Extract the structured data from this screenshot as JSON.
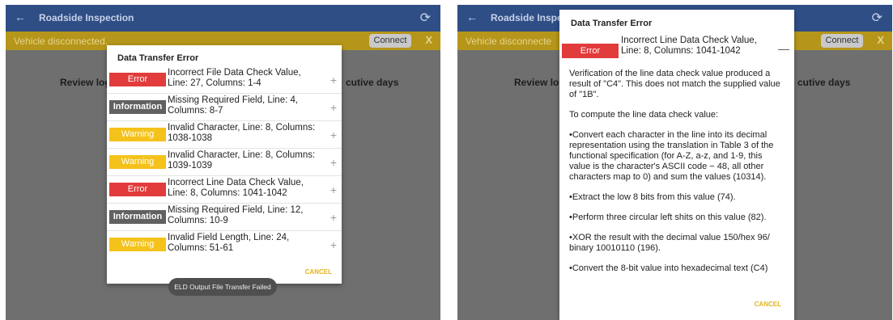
{
  "app": {
    "title": "Roadside Inspection",
    "title_truncated": "Roadside Inspecti",
    "back_glyph": "←",
    "refresh_glyph": "⟳"
  },
  "banner": {
    "text": "Vehicle disconnected.",
    "text_truncated": "Vehicle disconnecte",
    "connect_label": "Connect",
    "close_label": "X"
  },
  "background": {
    "review_left": "Review log",
    "review_right": "Review log",
    "days_text": "cutive days"
  },
  "dialog": {
    "title": "Data Transfer Error",
    "cancel_label": "CANCEL",
    "expand_glyph": "+",
    "collapse_glyph": "—",
    "errors": [
      {
        "type": "Error",
        "text": "Incorrect File Data Check Value, Line: 27, Columns: 1-4"
      },
      {
        "type": "Information",
        "text": "Missing Required Field, Line: 4, Columns: 8-7"
      },
      {
        "type": "Warning",
        "text": "Invalid Character, Line: 8, Columns: 1038-1038"
      },
      {
        "type": "Warning",
        "text": "Invalid Character, Line: 8, Columns: 1039-1039"
      },
      {
        "type": "Error",
        "text": "Incorrect Line Data Check Value, Line: 8, Columns: 1041-1042"
      },
      {
        "type": "Information",
        "text": "Missing Required Field, Line: 12, Columns: 10-9"
      },
      {
        "type": "Warning",
        "text": "Invalid Field Length, Line: 24, Columns: 51-61"
      }
    ]
  },
  "toast": "ELD Output File Transfer Failed",
  "detail": {
    "type": "Error",
    "heading": "Incorrect Line Data Check Value, Line: 8, Columns: 1041-1042",
    "paragraphs": [
      "Verification of the line data check value produced a result of \"C4\". This does not match the supplied value of \"1B\".",
      "To compute the line data check value:",
      "•Convert each character in the line into its decimal representation using the translation in Table 3 of the functional specification (for A-Z, a-z, and 1-9, this value is the character's ASCII code − 48, all other characters map to 0) and sum the values (10314).",
      "•Extract the low 8 bits from this value (74).",
      "•Perform three circular left shits on this value (82).",
      "•XOR the result with the decimal value 150/hex 96/ binary 10010110 (196).",
      "•Convert the 8-bit value into hexadecimal text (C4)"
    ]
  },
  "colors": {
    "appbar": "#2f4e86",
    "banner": "#b6961a",
    "error": "#e23b3b",
    "information": "#616161",
    "warning": "#f4c21a",
    "cancel": "#e2b41c"
  }
}
